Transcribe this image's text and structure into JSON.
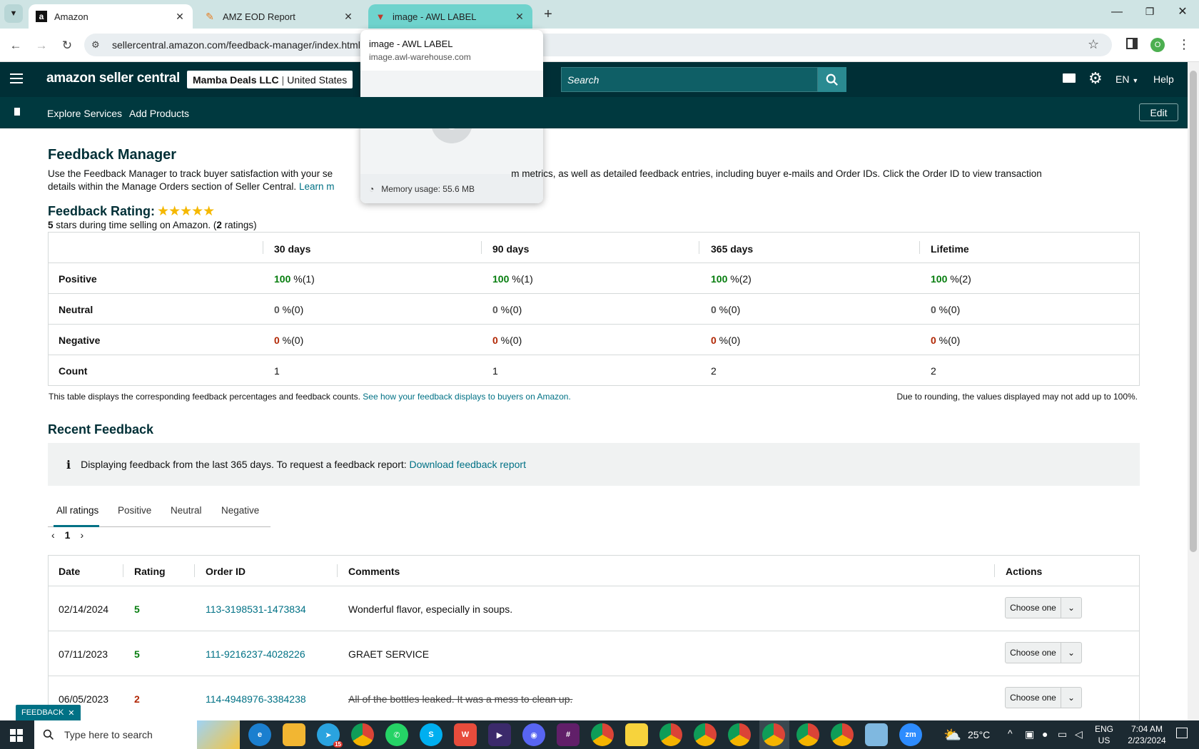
{
  "browser": {
    "tabs": [
      {
        "title": "Amazon",
        "icon": "amazon-icon"
      },
      {
        "title": "AMZ EOD Report",
        "icon": "report-icon"
      },
      {
        "title": "image - AWL LABEL",
        "icon": "awl-icon"
      }
    ],
    "url": "sellercentral.amazon.com/feedback-manager/index.html",
    "hover_card": {
      "title": "image - AWL LABEL",
      "domain": "image.awl-warehouse.com",
      "memory": "Memory usage: 55.6 MB"
    },
    "profile_initial": "O"
  },
  "header": {
    "logo": "amazon seller central",
    "account": "Mamba Deals LLC",
    "marketplace": "United States",
    "search_placeholder": "Search",
    "language": "EN",
    "help": "Help"
  },
  "nav": {
    "items": [
      "Explore Services",
      "Add Products"
    ],
    "edit": "Edit"
  },
  "page": {
    "title": "Feedback Manager",
    "intro_a": "Use the Feedback Manager to track buyer satisfaction with your se",
    "intro_b": "m metrics, as well as detailed feedback entries, including buyer e-mails and Order IDs. Click the Order ID to view transaction",
    "intro_line2": "details within the Manage Orders section of Seller Central.",
    "learn_more": "Learn m",
    "rating_title": "Feedback Rating:",
    "rating_stars": 5,
    "rating_summary_a": "5",
    "rating_summary_b": " stars during time selling on Amazon. (",
    "rating_summary_c": "2",
    "rating_summary_d": " ratings)"
  },
  "rating_table": {
    "columns": [
      "30 days",
      "90 days",
      "365 days",
      "Lifetime"
    ],
    "rows": [
      {
        "label": "Positive",
        "cells": [
          [
            "100",
            " %(1)"
          ],
          [
            "100",
            " %(1)"
          ],
          [
            "100",
            " %(2)"
          ],
          [
            "100",
            " %(2)"
          ]
        ]
      },
      {
        "label": "Neutral",
        "cells": [
          [
            "0",
            " %(0)"
          ],
          [
            "0",
            " %(0)"
          ],
          [
            "0",
            " %(0)"
          ],
          [
            "0",
            " %(0)"
          ]
        ]
      },
      {
        "label": "Negative",
        "cells": [
          [
            "0",
            " %(0)"
          ],
          [
            "0",
            " %(0)"
          ],
          [
            "0",
            " %(0)"
          ],
          [
            "0",
            " %(0)"
          ]
        ]
      },
      {
        "label": "Count",
        "cells": [
          [
            "",
            "1"
          ],
          [
            "",
            "1"
          ],
          [
            "",
            "2"
          ],
          [
            "",
            "2"
          ]
        ]
      }
    ],
    "footnote": "This table displays the corresponding feedback percentages and feedback counts.",
    "footnote_link": "See how your feedback displays to buyers on Amazon.",
    "rounding_note": "Due to rounding, the values displayed may not add up to 100%."
  },
  "recent": {
    "title": "Recent Feedback",
    "info": "Displaying feedback from the last 365 days. To request a feedback report:",
    "info_link": "Download feedback report",
    "tabs": [
      "All ratings",
      "Positive",
      "Neutral",
      "Negative"
    ],
    "page": "1",
    "columns": [
      "Date",
      "Rating",
      "Order ID",
      "Comments",
      "Actions"
    ],
    "rows": [
      {
        "date": "02/14/2024",
        "rating": "5",
        "order": "113-3198531-1473834",
        "comment": "Wonderful flavor, especially in soups.",
        "action": "Choose one"
      },
      {
        "date": "07/11/2023",
        "rating": "5",
        "order": "111-9216237-4028226",
        "comment": "GRAET SERVICE",
        "action": "Choose one"
      },
      {
        "date": "06/05/2023",
        "rating": "2",
        "order": "114-4948976-3384238",
        "comment": "All of the bottles leaked. It was a mess to clean up.",
        "action": "Choose one"
      }
    ]
  },
  "feedback_button": "FEEDBACK",
  "taskbar": {
    "search_placeholder": "Type here to search",
    "weather": "25°C",
    "lang_a": "ENG",
    "lang_b": "US",
    "time": "7:04 AM",
    "date": "2/23/2024",
    "telegram_badge": "15"
  }
}
